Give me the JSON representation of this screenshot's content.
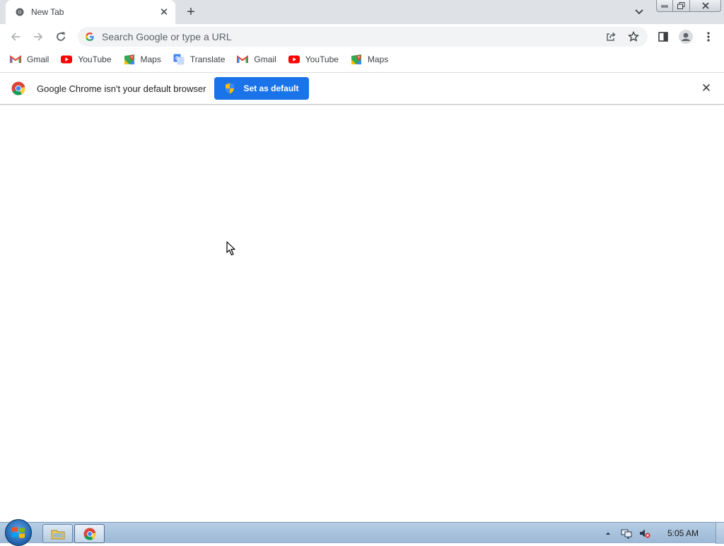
{
  "tab": {
    "title": "New Tab",
    "close_label": "✕",
    "new_tab_label": "+"
  },
  "toolbar": {
    "omnibox_placeholder": "Search Google or type a URL"
  },
  "bookmarks": [
    {
      "label": "Gmail",
      "icon": "gmail-icon"
    },
    {
      "label": "YouTube",
      "icon": "youtube-icon"
    },
    {
      "label": "Maps",
      "icon": "maps-icon"
    },
    {
      "label": "Translate",
      "icon": "translate-icon"
    },
    {
      "label": "Gmail",
      "icon": "gmail-icon"
    },
    {
      "label": "YouTube",
      "icon": "youtube-icon"
    },
    {
      "label": "Maps",
      "icon": "maps-icon"
    }
  ],
  "infobar": {
    "message": "Google Chrome isn't your default browser",
    "button_label": "Set as default",
    "close_label": "✕"
  },
  "taskbar": {
    "clock": "5:05 AM"
  },
  "colors": {
    "accent": "#1a73e8",
    "tabstrip": "#dee1e6",
    "omnibox": "#f1f3f4",
    "youtube_red": "#ff0000"
  }
}
